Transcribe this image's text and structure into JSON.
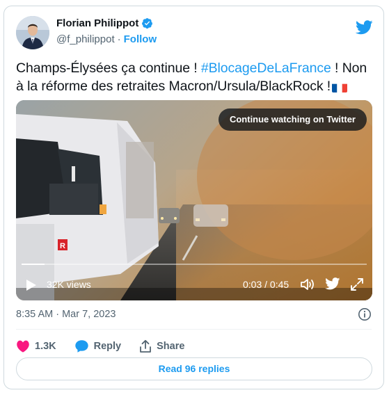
{
  "author": {
    "name": "Florian Philippot",
    "handle": "@f_philippot",
    "separator": "·",
    "follow_label": "Follow"
  },
  "tweet": {
    "text_before": "Champs-Élysées ça continue ! ",
    "hashtag": "#BlocageDeLaFrance",
    "text_after": " ! Non à la réforme des retraites Macron/Ursula/BlackRock !",
    "flag_icon": "france-flag-icon"
  },
  "video": {
    "overlay_label": "Continue watching on Twitter",
    "views": "32K views",
    "time": "0:03 / 0:45",
    "progress": 0.067,
    "van_logo_text": "R"
  },
  "meta": {
    "timestamp": "8:35 AM · Mar 7, 2023"
  },
  "actions": {
    "likes": "1.3K",
    "reply_label": "Reply",
    "share_label": "Share",
    "read_replies_label": "Read 96 replies"
  },
  "colors": {
    "accent": "#1d9bf0",
    "like": "#f91880",
    "text": "#0f1419",
    "muted": "#536471"
  }
}
